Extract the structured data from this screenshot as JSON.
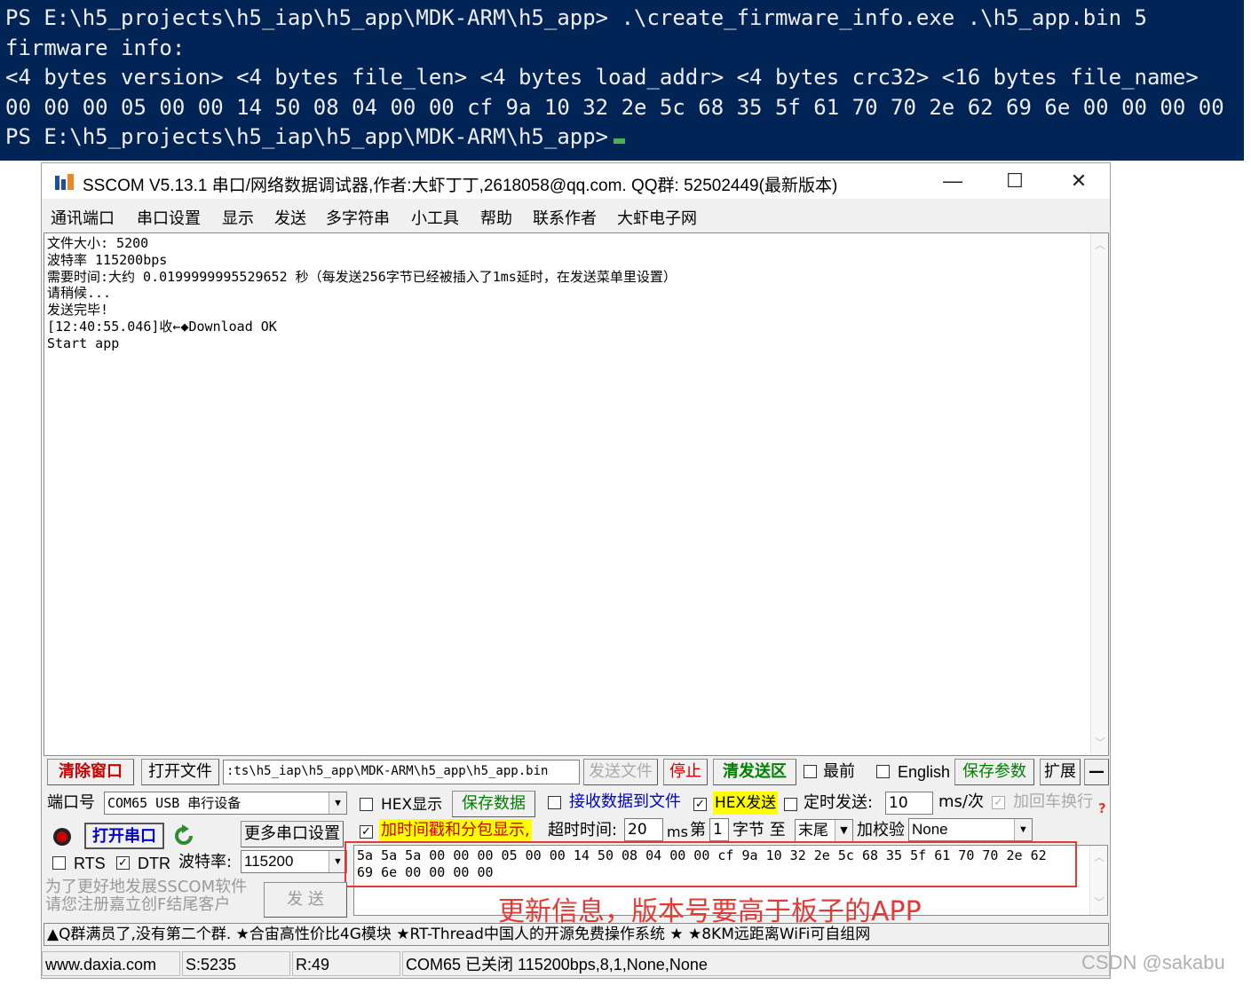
{
  "terminal": {
    "lines": [
      "PS E:\\h5_projects\\h5_iap\\h5_app\\MDK-ARM\\h5_app> .\\create_firmware_info.exe .\\h5_app.bin 5",
      "firmware info:",
      "<4 bytes version> <4 bytes file_len> <4 bytes load_addr> <4 bytes crc32> <16 bytes file_name>",
      "00 00 00 05 00 00 14 50 08 04 00 00 cf 9a 10 32 2e 5c 68 35 5f 61 70 70 2e 62 69 6e 00 00 00 00",
      "PS E:\\h5_projects\\h5_iap\\h5_app\\MDK-ARM\\h5_app>"
    ]
  },
  "window": {
    "title": "SSCOM V5.13.1 串口/网络数据调试器,作者:大虾丁丁,2618058@qq.com. QQ群: 52502449(最新版本)",
    "minimize": "—",
    "maximize": "☐",
    "close": "✕"
  },
  "menu": [
    "通讯端口",
    "串口设置",
    "显示",
    "发送",
    "多字符串",
    "小工具",
    "帮助",
    "联系作者",
    "大虾电子网"
  ],
  "receive": {
    "lines": [
      "文件大小: 5200",
      "波特率 115200bps",
      "需要时间:大约 0.0199999995529652 秒（每发送256字节已经被插入了1ms延时，在发送菜单里设置）",
      "请稍候...",
      "发送完毕!",
      "[12:40:55.046]收←◆Download OK",
      "Start app"
    ]
  },
  "toolbar": {
    "clear": "清除窗口",
    "open_file": "打开文件",
    "file_path": ":ts\\h5_iap\\h5_app\\MDK-ARM\\h5_app\\h5_app.bin",
    "send_file": "发送文件",
    "stop": "停止",
    "clear_send": "清发送区",
    "topmost": "最前",
    "english": "English",
    "save_params": "保存参数",
    "expand": "扩展",
    "collapse": "—"
  },
  "port": {
    "label": "端口号",
    "value": "COM65 USB 串行设备",
    "open_btn": "打开串口",
    "more_settings": "更多串口设置",
    "rts": "RTS",
    "dtr": "DTR",
    "baud_label": "波特率:",
    "baud": "115200"
  },
  "options": {
    "hex_display": "HEX显示",
    "save_data": "保存数据",
    "recv_to_file": "接收数据到文件",
    "hex_send": "HEX发送",
    "timed_send": "定时发送:",
    "interval": "10",
    "interval_unit": "ms/次",
    "append_crlf": "加回车换行",
    "timestamp": "加时间戳和分包显示,",
    "timeout_label": "超时时间:",
    "timeout": "20",
    "timeout_unit": "ms",
    "byte_label": "第",
    "byte_index": "1",
    "byte_unit": "字节 至",
    "byte_end": "末尾",
    "checksum_label": "加校验",
    "checksum": "None"
  },
  "send": {
    "lines": [
      "5a 5a 5a 00 00 00 05 00 00 14 50 08 04 00 00 cf 9a 10 32 2e 5c 68 35 5f 61 70 70 2e 62",
      "69 6e 00 00 00 00"
    ],
    "button": "发 送"
  },
  "promo": [
    "为了更好地发展SSCOM软件",
    "请您注册嘉立创F结尾客户"
  ],
  "annotation": "更新信息，版本号要高于板子的APP",
  "ticker": "▲Q群满员了,没有第二个群. ★合宙高性价比4G模块 ★RT-Thread中国人的开源免费操作系统 ★ ★8KM远距离WiFi可自组网",
  "status": {
    "site": "www.daxia.com",
    "sent": "S:5235",
    "received": "R:49",
    "port_state": "COM65 已关闭  115200bps,8,1,None,None"
  },
  "watermark": "CSDN @sakabu",
  "colors": {
    "terminal_bg": "#012456",
    "highlight": "#ffff00",
    "accent_red": "#e53935",
    "blue_link": "#0000cc",
    "green_text": "#008000"
  }
}
